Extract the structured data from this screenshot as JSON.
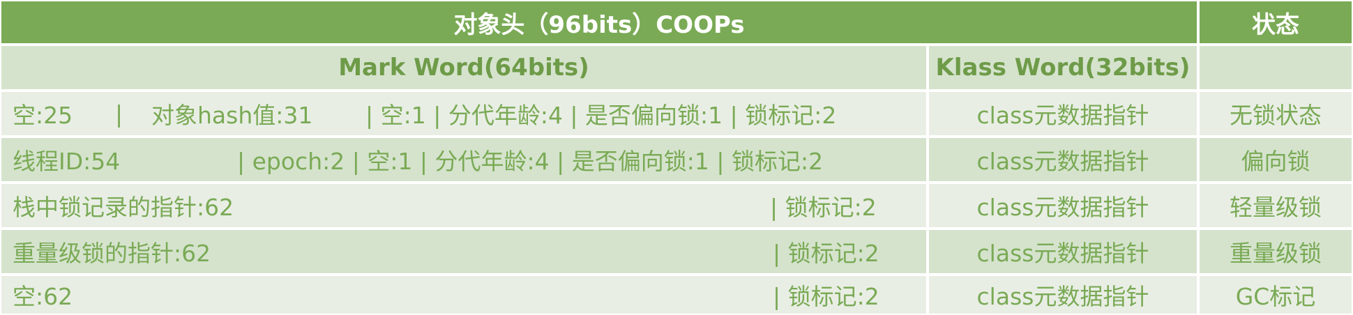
{
  "header": {
    "title": "对象头（96bits）COOPs",
    "status_label": "状态"
  },
  "subheader": {
    "mark_word": "Mark Word(64bits)",
    "klass_word": "Klass Word(32bits)",
    "status_blank": ""
  },
  "rows": [
    {
      "segments": [
        "空:25",
        "|",
        "对象hash值:31",
        "| 空:1 | 分代年龄:4 | 是否偏向锁:1 | 锁标记:2"
      ],
      "klass": "class元数据指针",
      "status": "无锁状态"
    },
    {
      "segments": [
        "线程ID:54",
        "| epoch:2  | 空:1 | 分代年龄:4 | 是否偏向锁:1 | 锁标记:2"
      ],
      "klass": "class元数据指针",
      "status": "偏向锁"
    },
    {
      "segments": [
        "栈中锁记录的指针:62",
        "| 锁标记:2"
      ],
      "klass": "class元数据指针",
      "status": "轻量级锁"
    },
    {
      "segments": [
        "重量级锁的指针:62",
        "| 锁标记:2"
      ],
      "klass": "class元数据指针",
      "status": "重量级锁"
    },
    {
      "segments": [
        "空:62",
        "| 锁标记:2"
      ],
      "klass": "class元数据指针",
      "status": "GC标记"
    }
  ]
}
